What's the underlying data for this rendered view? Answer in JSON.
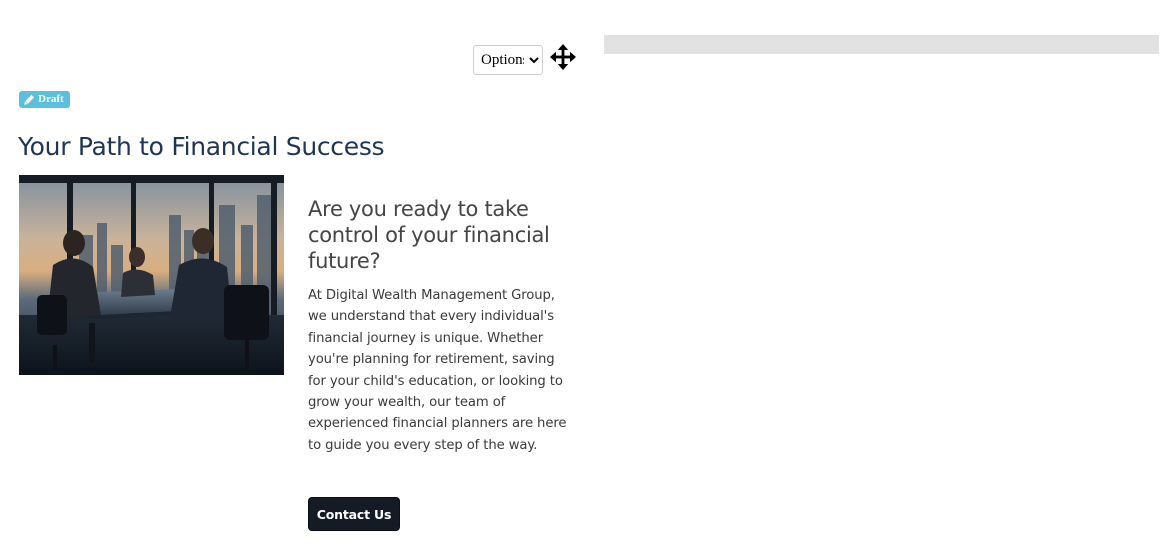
{
  "options_select": {
    "selected": "Options",
    "options": [
      "Options"
    ]
  },
  "move_handle": {
    "icon": "move-arrows-icon"
  },
  "badge": {
    "icon": "pencil-icon",
    "label": "Draft",
    "color": "#5bc0de"
  },
  "content": {
    "title": "Your Path to Financial Success",
    "subheading": "Are you ready to take control of your financial future?",
    "body": "At Digital Wealth Management Group, we understand that every individual's financial journey is unique. Whether you're planning for retirement, saving for your child's education, or looking to grow your wealth, our team of experienced financial planners are here to guide you every step of the way.",
    "cta_label": "Contact Us"
  },
  "colors": {
    "title": "#1f3556",
    "button_bg": "#141b24",
    "gray_bar": "#e2e2e2"
  }
}
